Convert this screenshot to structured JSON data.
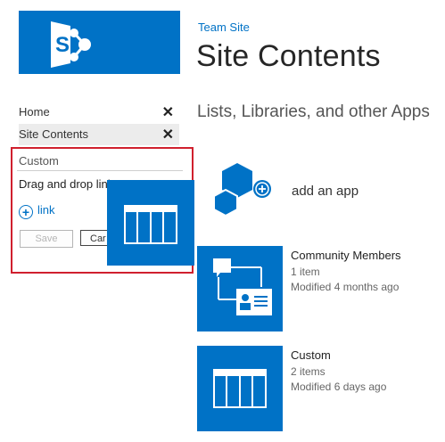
{
  "header": {
    "logo": {
      "icon": "sharepoint-logo-icon",
      "letter": "S",
      "color": "#0072c6"
    },
    "breadcrumb": "Team Site",
    "title": "Site Contents"
  },
  "nav": {
    "items": [
      {
        "label": "Home",
        "close": "✕"
      },
      {
        "label": "Site Contents",
        "close": "✕"
      }
    ]
  },
  "edit_panel": {
    "custom_input_value": "Custom",
    "drag_text": "Drag and drop link",
    "add_link_label": "link",
    "save_label": "Save",
    "cancel_label": "Car"
  },
  "main": {
    "section_title": "Lists, Libraries, and other Apps",
    "add_app_label": "add an app",
    "apps": [
      {
        "name": "Community Members",
        "items": "1 item",
        "modified": "Modified 4 months ago",
        "icon": "community-members-icon"
      },
      {
        "name": "Custom",
        "items": "2 items",
        "modified": "Modified 6 days ago",
        "icon": "list-icon"
      }
    ]
  },
  "colors": {
    "accent": "#0072c6",
    "highlight_border": "#d0202e"
  }
}
